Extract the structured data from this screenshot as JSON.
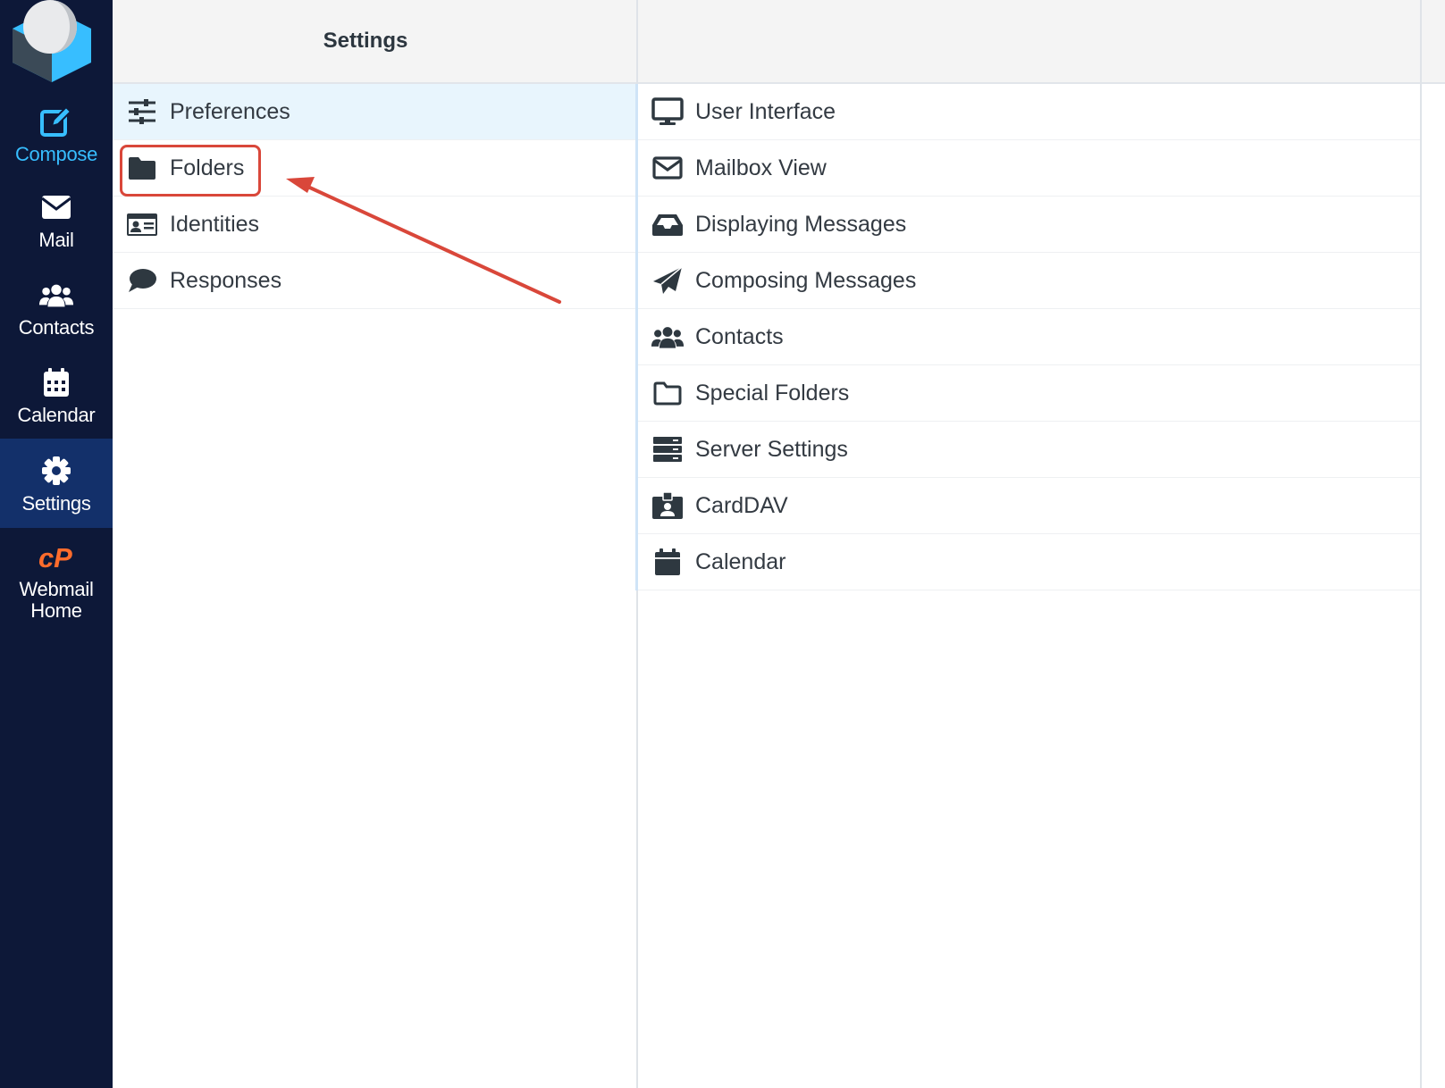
{
  "nav": {
    "items": [
      {
        "id": "compose",
        "label": "Compose",
        "icon": "compose-icon"
      },
      {
        "id": "mail",
        "label": "Mail",
        "icon": "envelope-icon"
      },
      {
        "id": "contacts",
        "label": "Contacts",
        "icon": "users-icon"
      },
      {
        "id": "calendar",
        "label": "Calendar",
        "icon": "calendar-icon"
      },
      {
        "id": "settings",
        "label": "Settings",
        "icon": "gear-icon",
        "active": true
      },
      {
        "id": "webmail_home",
        "label": "Webmail\nHome",
        "icon": "cpanel-icon"
      }
    ],
    "colors": {
      "background": "#0d1838",
      "active": "#13306a",
      "accent": "#37beff",
      "cpanel": "#ff6c2c"
    }
  },
  "sections": {
    "header": "Settings",
    "items": [
      {
        "label": "Preferences",
        "icon": "sliders-icon",
        "selected": true
      },
      {
        "label": "Folders",
        "icon": "folder-icon",
        "highlighted": true
      },
      {
        "label": "Identities",
        "icon": "id-card-icon"
      },
      {
        "label": "Responses",
        "icon": "speech-bubble-icon"
      }
    ]
  },
  "preferences": {
    "items": [
      {
        "label": "User Interface",
        "icon": "monitor-icon"
      },
      {
        "label": "Mailbox View",
        "icon": "envelope-outline-icon"
      },
      {
        "label": "Displaying Messages",
        "icon": "inbox-icon"
      },
      {
        "label": "Composing Messages",
        "icon": "paper-plane-icon"
      },
      {
        "label": "Contacts",
        "icon": "users-icon"
      },
      {
        "label": "Special Folders",
        "icon": "folder-outline-icon"
      },
      {
        "label": "Server Settings",
        "icon": "server-icon"
      },
      {
        "label": "CardDAV",
        "icon": "contact-badge-icon"
      },
      {
        "label": "Calendar",
        "icon": "calendar-icon"
      }
    ]
  },
  "annotation": {
    "color": "#d9473a"
  }
}
